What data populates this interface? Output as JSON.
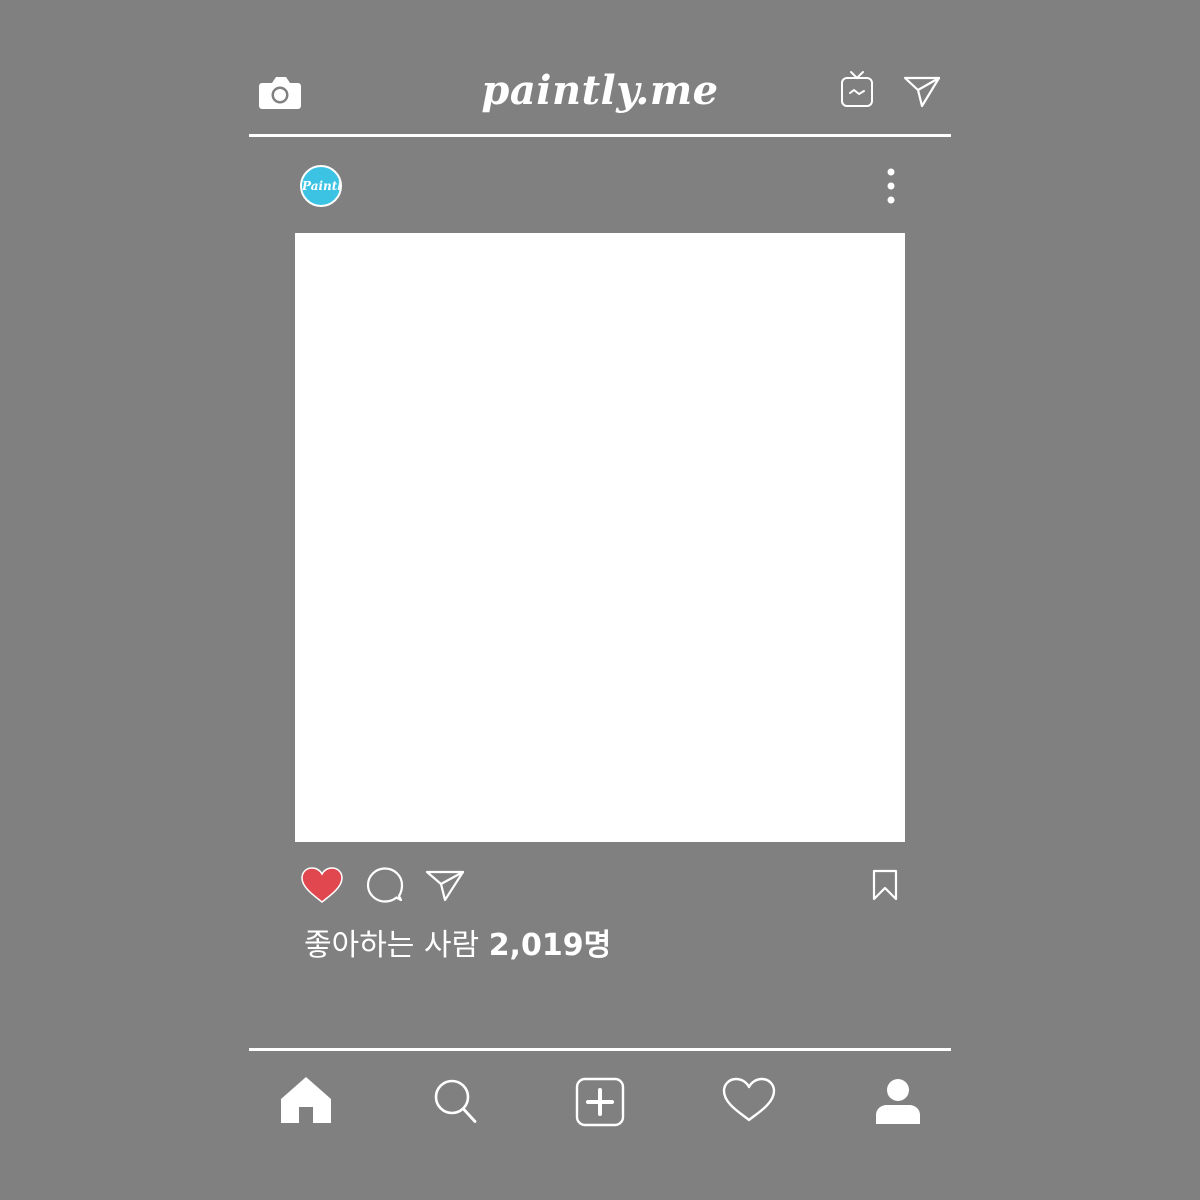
{
  "header": {
    "brand": "paintly.me",
    "icons": [
      "camera-icon",
      "igtv-icon",
      "direct-message-icon"
    ]
  },
  "post": {
    "avatar_text": "Paintly",
    "more_icon": "more-options-icon",
    "actions": [
      "like-heart-icon",
      "comment-icon",
      "share-icon",
      "bookmark-icon"
    ],
    "likes_prefix": "좋아하는 사람 ",
    "likes_count": "2,019명"
  },
  "bottom_nav": [
    "home-icon",
    "search-icon",
    "new-post-icon",
    "activity-heart-icon",
    "profile-icon"
  ],
  "colors": {
    "background": "#808080",
    "foreground": "#ffffff",
    "like_red": "#e0474e",
    "avatar": "#3cc3e4"
  }
}
